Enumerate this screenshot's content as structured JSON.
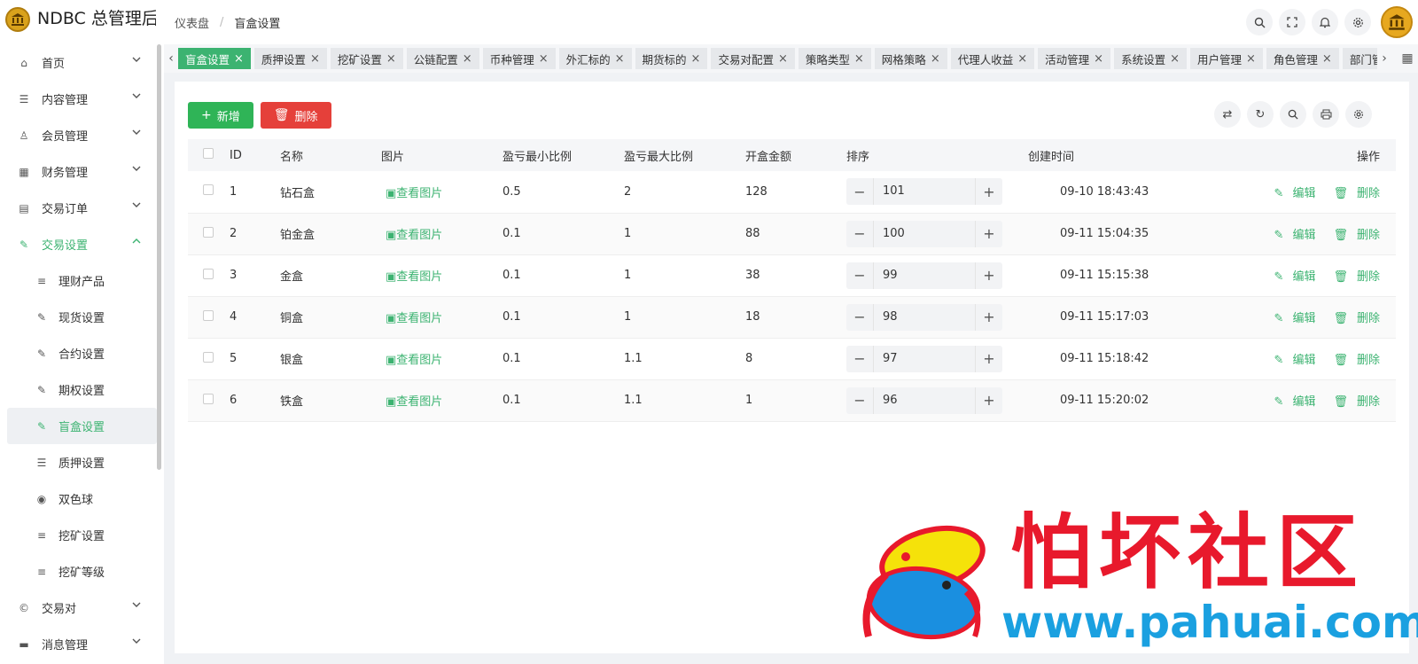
{
  "header": {
    "title": "NDBC 总管理后台",
    "breadcrumb": [
      "仪表盘",
      "盲盒设置"
    ],
    "sep": "/"
  },
  "sidebar": {
    "items": [
      {
        "label": "首页",
        "icon": "home-icon",
        "glyph": "⌂"
      },
      {
        "label": "内容管理",
        "icon": "list-icon",
        "glyph": "☰"
      },
      {
        "label": "会员管理",
        "icon": "user-icon",
        "glyph": "♙"
      },
      {
        "label": "财务管理",
        "icon": "table-icon",
        "glyph": "▦"
      },
      {
        "label": "交易订单",
        "icon": "order-icon",
        "glyph": "▤"
      },
      {
        "label": "交易设置",
        "icon": "wrench-icon",
        "glyph": "✎",
        "open": true
      }
    ],
    "sub_items": [
      {
        "label": "理财产品",
        "icon": "lines-icon",
        "glyph": "≡"
      },
      {
        "label": "现货设置",
        "icon": "wrench-icon",
        "glyph": "✎"
      },
      {
        "label": "合约设置",
        "icon": "wrench-icon",
        "glyph": "✎"
      },
      {
        "label": "期权设置",
        "icon": "wrench-icon",
        "glyph": "✎"
      },
      {
        "label": "盲盒设置",
        "icon": "wrench-icon",
        "glyph": "✎",
        "active": true
      },
      {
        "label": "质押设置",
        "icon": "list-icon",
        "glyph": "☰"
      },
      {
        "label": "双色球",
        "icon": "target-icon",
        "glyph": "◉"
      },
      {
        "label": "挖矿设置",
        "icon": "lines-icon",
        "glyph": "≡"
      },
      {
        "label": "挖矿等级",
        "icon": "lines-icon",
        "glyph": "≡"
      }
    ],
    "bottom_items": [
      {
        "label": "交易对",
        "icon": "copyright-icon",
        "glyph": "©"
      },
      {
        "label": "消息管理",
        "icon": "message-icon",
        "glyph": "▬"
      }
    ]
  },
  "tabs": [
    {
      "label": "盲盒设置",
      "active": true
    },
    {
      "label": "质押设置"
    },
    {
      "label": "挖矿设置"
    },
    {
      "label": "公链配置"
    },
    {
      "label": "币种管理"
    },
    {
      "label": "外汇标的"
    },
    {
      "label": "期货标的"
    },
    {
      "label": "交易对配置"
    },
    {
      "label": "策略类型"
    },
    {
      "label": "网格策略"
    },
    {
      "label": "代理人收益"
    },
    {
      "label": "活动管理"
    },
    {
      "label": "系统设置"
    },
    {
      "label": "用户管理"
    },
    {
      "label": "角色管理"
    },
    {
      "label": "部门管理"
    }
  ],
  "toolbar": {
    "add_label": "新增",
    "delete_label": "删除"
  },
  "table": {
    "columns": [
      "ID",
      "名称",
      "图片",
      "盈亏最小比例",
      "盈亏最大比例",
      "开盒金额",
      "排序",
      "创建时间",
      "操作"
    ],
    "view_image_label": "查看图片",
    "edit_label": "编辑",
    "delete_label": "删除",
    "rows": [
      {
        "id": "1",
        "name": "钻石盒",
        "min": "0.5",
        "max": "2",
        "amount": "128",
        "sort": "101",
        "created": "09-10 18:43:43"
      },
      {
        "id": "2",
        "name": "铂金盒",
        "min": "0.1",
        "max": "1",
        "amount": "88",
        "sort": "100",
        "created": "09-11 15:04:35"
      },
      {
        "id": "3",
        "name": "金盒",
        "min": "0.1",
        "max": "1",
        "amount": "38",
        "sort": "99",
        "created": "09-11 15:15:38"
      },
      {
        "id": "4",
        "name": "铜盒",
        "min": "0.1",
        "max": "1",
        "amount": "18",
        "sort": "98",
        "created": "09-11 15:17:03"
      },
      {
        "id": "5",
        "name": "银盒",
        "min": "0.1",
        "max": "1.1",
        "amount": "8",
        "sort": "97",
        "created": "09-11 15:18:42"
      },
      {
        "id": "6",
        "name": "铁盒",
        "min": "0.1",
        "max": "1.1",
        "amount": "1",
        "sort": "96",
        "created": "09-11 15:20:02"
      }
    ]
  },
  "watermark": {
    "text": "怕坏社区",
    "url": "www.pahuai.com"
  },
  "colors": {
    "accent": "#3cb371",
    "add_button": "#2fb457",
    "delete_button": "#e5403a"
  }
}
